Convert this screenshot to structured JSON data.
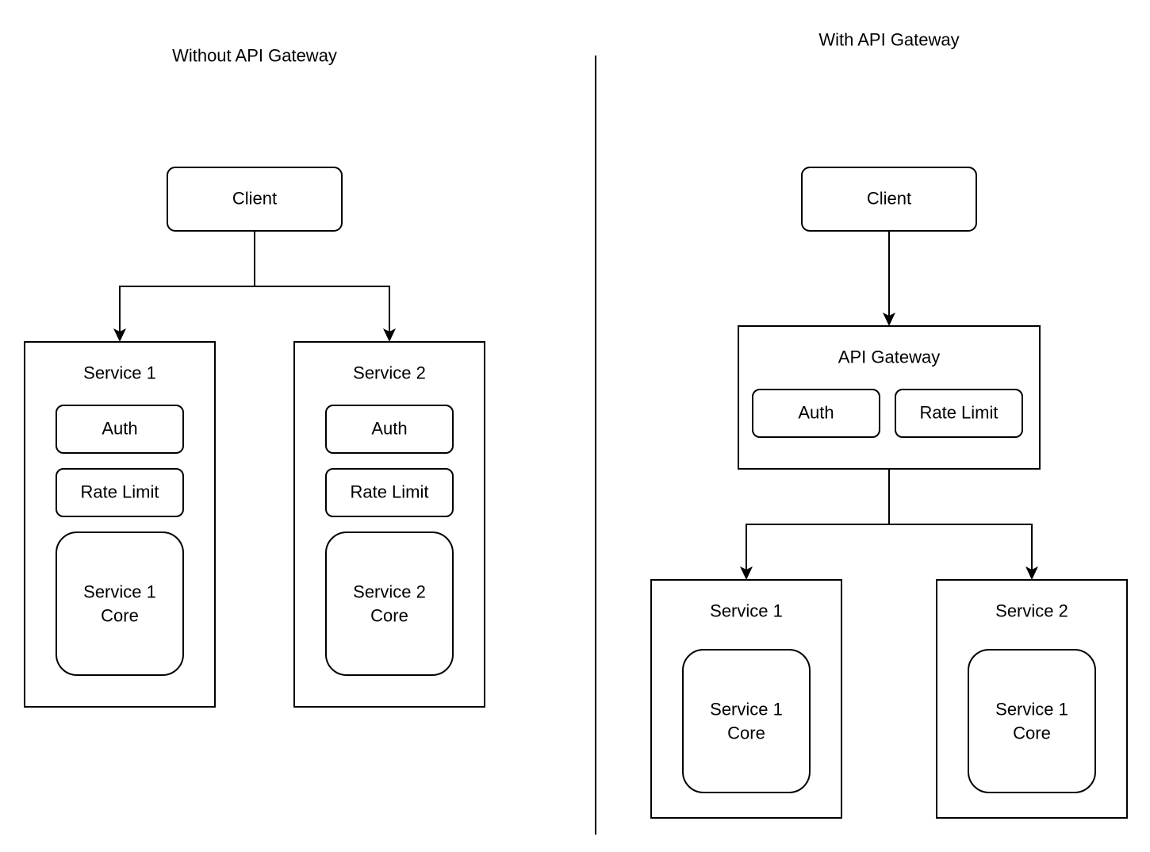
{
  "left_panel": {
    "title": "Without API Gateway",
    "client": "Client",
    "services": [
      {
        "title": "Service 1",
        "auth": "Auth",
        "rate_limit": "Rate Limit",
        "core_line1": "Service 1",
        "core_line2": "Core"
      },
      {
        "title": "Service 2",
        "auth": "Auth",
        "rate_limit": "Rate Limit",
        "core_line1": "Service 2",
        "core_line2": "Core"
      }
    ]
  },
  "right_panel": {
    "title": "With API Gateway",
    "client": "Client",
    "gateway": {
      "title": "API Gateway",
      "auth": "Auth",
      "rate_limit": "Rate Limit"
    },
    "services": [
      {
        "title": "Service 1",
        "core_line1": "Service 1",
        "core_line2": "Core"
      },
      {
        "title": "Service 2",
        "core_line1": "Service 1",
        "core_line2": "Core"
      }
    ]
  }
}
